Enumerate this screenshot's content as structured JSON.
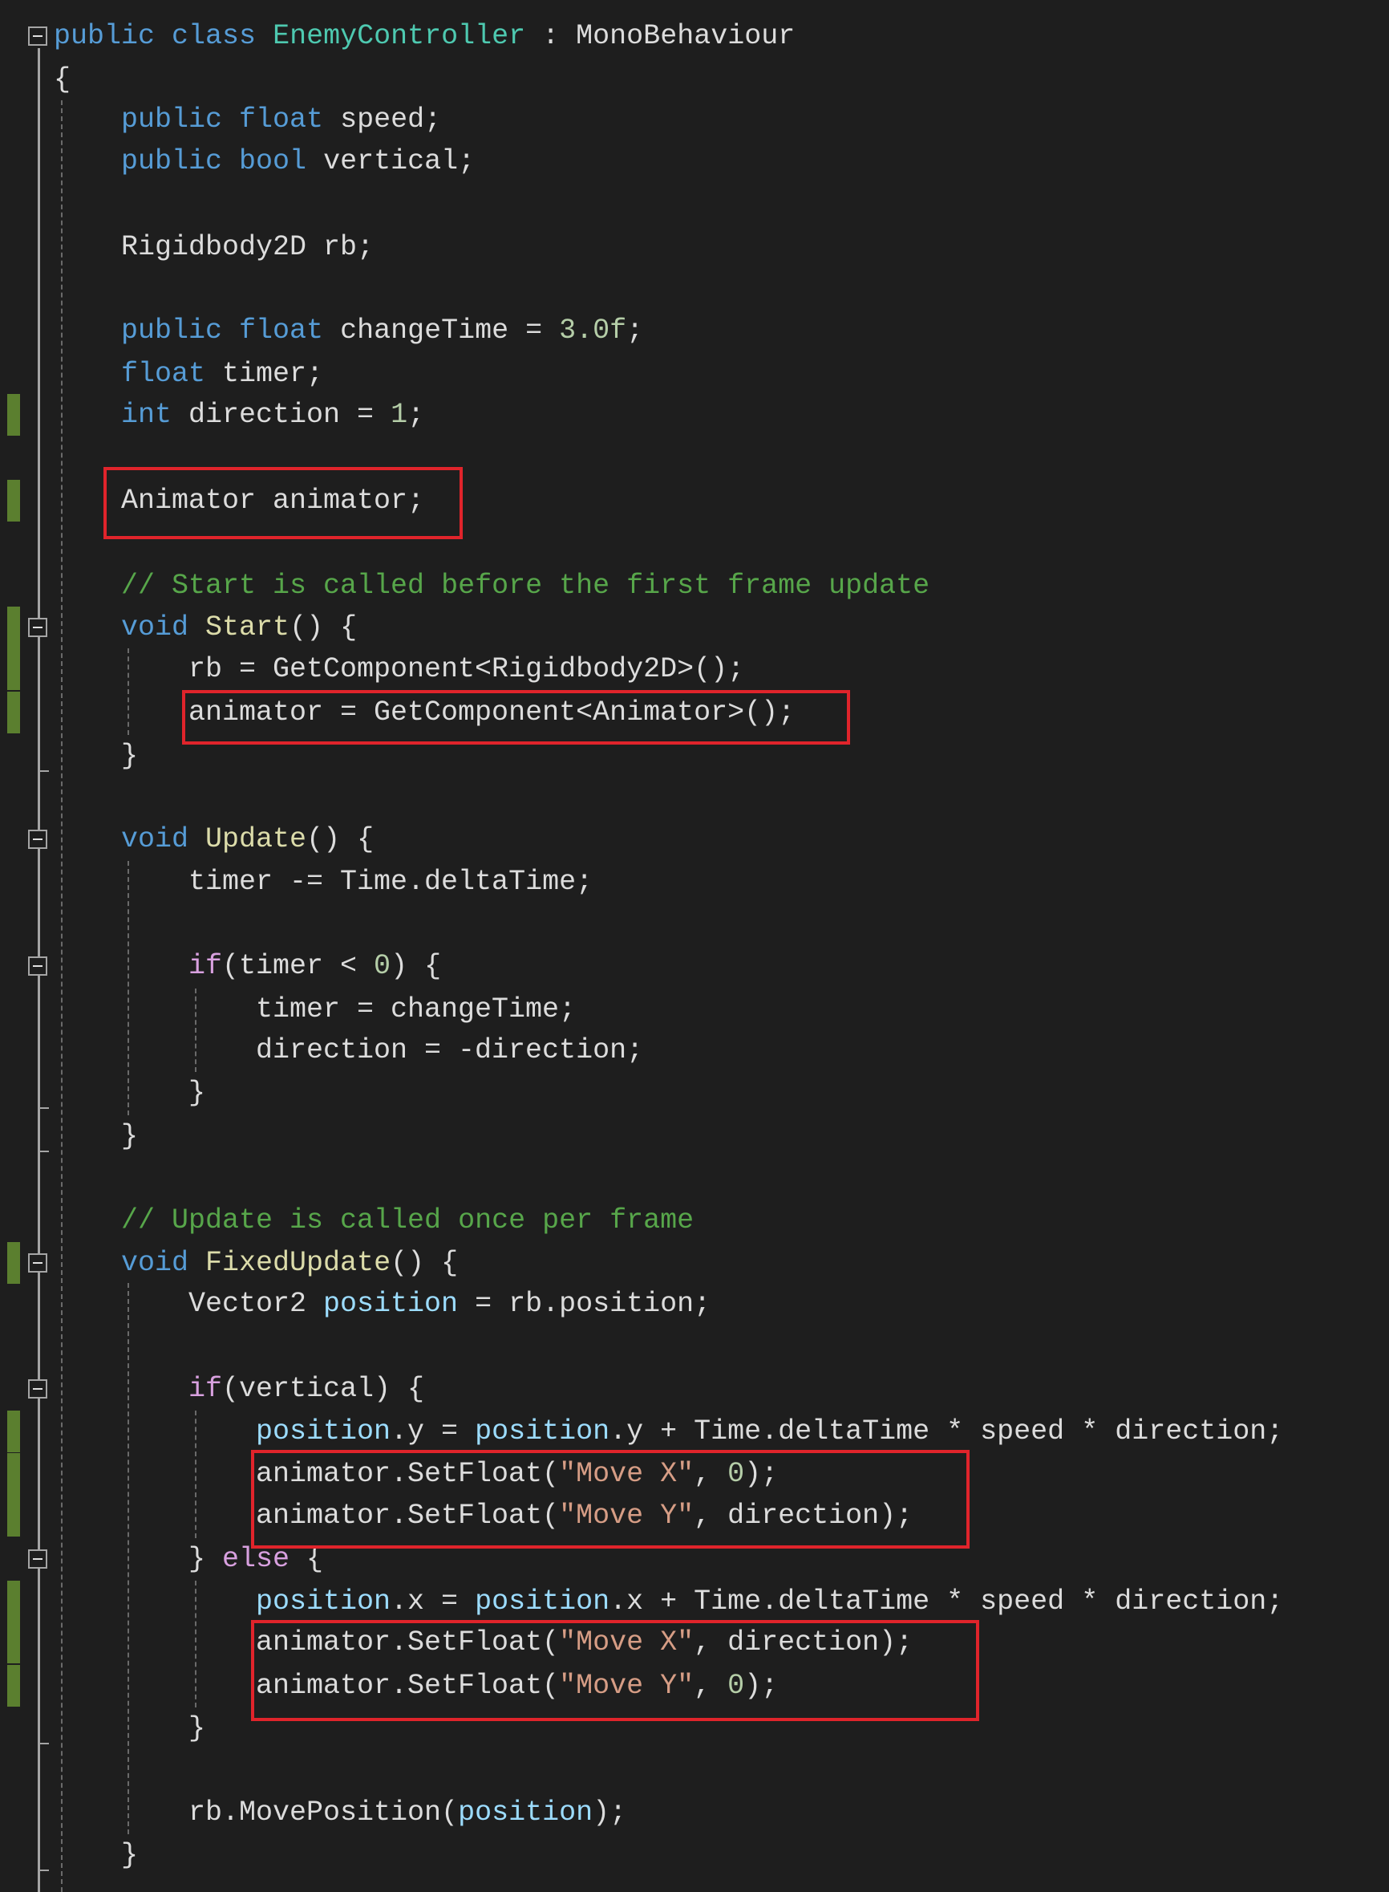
{
  "editor": {
    "language": "C#",
    "colors": {
      "background": "#1e1e1e",
      "keyword": "#569cd6",
      "control_keyword": "#d8a0df",
      "type": "#4ec9b0",
      "method": "#dcdcaa",
      "string": "#d69d85",
      "number": "#b5cea8",
      "comment": "#57a64a",
      "local_variable": "#9cdcfe",
      "plain": "#dcdcdc",
      "change_marker": "#5b7f2f",
      "highlight_box": "#e0242b"
    },
    "lines": [
      {
        "indent": 0,
        "tokens": [
          [
            "kw",
            "public"
          ],
          [
            "plain",
            " "
          ],
          [
            "kw",
            "class"
          ],
          [
            "plain",
            " "
          ],
          [
            "type",
            "EnemyController"
          ],
          [
            "plain",
            " : "
          ],
          [
            "plain",
            "MonoBehaviour"
          ]
        ]
      },
      {
        "indent": 0,
        "tokens": [
          [
            "plain",
            "{"
          ]
        ]
      },
      {
        "indent": 1,
        "tokens": [
          [
            "kw",
            "public"
          ],
          [
            "plain",
            " "
          ],
          [
            "kw",
            "float"
          ],
          [
            "plain",
            " speed;"
          ]
        ]
      },
      {
        "indent": 1,
        "tokens": [
          [
            "kw",
            "public"
          ],
          [
            "plain",
            " "
          ],
          [
            "kw",
            "bool"
          ],
          [
            "plain",
            " vertical;"
          ]
        ]
      },
      {
        "indent": 1,
        "tokens": [
          [
            "plain",
            "Rigidbody2D rb;"
          ]
        ]
      },
      {
        "indent": 1,
        "tokens": [
          [
            "kw",
            "public"
          ],
          [
            "plain",
            " "
          ],
          [
            "kw",
            "float"
          ],
          [
            "plain",
            " changeTime = "
          ],
          [
            "num",
            "3.0f"
          ],
          [
            "plain",
            ";"
          ]
        ]
      },
      {
        "indent": 1,
        "tokens": [
          [
            "kw",
            "float"
          ],
          [
            "plain",
            " timer;"
          ]
        ]
      },
      {
        "indent": 1,
        "tokens": [
          [
            "kw",
            "int"
          ],
          [
            "plain",
            " direction = "
          ],
          [
            "num",
            "1"
          ],
          [
            "plain",
            ";"
          ]
        ]
      },
      {
        "indent": 1,
        "tokens": [
          [
            "plain",
            "Animator animator;"
          ]
        ]
      },
      {
        "indent": 1,
        "tokens": [
          [
            "cmt",
            "// Start is called before the first frame update"
          ]
        ]
      },
      {
        "indent": 1,
        "tokens": [
          [
            "kw",
            "void"
          ],
          [
            "plain",
            " "
          ],
          [
            "fn",
            "Start"
          ],
          [
            "plain",
            "() {"
          ]
        ]
      },
      {
        "indent": 2,
        "tokens": [
          [
            "plain",
            "rb = GetComponent<Rigidbody2D>();"
          ]
        ]
      },
      {
        "indent": 2,
        "tokens": [
          [
            "plain",
            "animator = GetComponent<Animator>();"
          ]
        ]
      },
      {
        "indent": 1,
        "tokens": [
          [
            "plain",
            "}"
          ]
        ]
      },
      {
        "indent": 1,
        "tokens": [
          [
            "kw",
            "void"
          ],
          [
            "plain",
            " "
          ],
          [
            "fn",
            "Update"
          ],
          [
            "plain",
            "() {"
          ]
        ]
      },
      {
        "indent": 2,
        "tokens": [
          [
            "plain",
            "timer -= Time.deltaTime;"
          ]
        ]
      },
      {
        "indent": 2,
        "tokens": [
          [
            "ctl",
            "if"
          ],
          [
            "plain",
            "(timer < "
          ],
          [
            "num",
            "0"
          ],
          [
            "plain",
            ") {"
          ]
        ]
      },
      {
        "indent": 3,
        "tokens": [
          [
            "plain",
            "timer = changeTime;"
          ]
        ]
      },
      {
        "indent": 3,
        "tokens": [
          [
            "plain",
            "direction = -direction;"
          ]
        ]
      },
      {
        "indent": 2,
        "tokens": [
          [
            "plain",
            "}"
          ]
        ]
      },
      {
        "indent": 1,
        "tokens": [
          [
            "plain",
            "}"
          ]
        ]
      },
      {
        "indent": 1,
        "tokens": [
          [
            "cmt",
            "// Update is called once per frame"
          ]
        ]
      },
      {
        "indent": 1,
        "tokens": [
          [
            "kw",
            "void"
          ],
          [
            "plain",
            " "
          ],
          [
            "fn",
            "FixedUpdate"
          ],
          [
            "plain",
            "() {"
          ]
        ]
      },
      {
        "indent": 2,
        "tokens": [
          [
            "plain",
            "Vector2 "
          ],
          [
            "var",
            "position"
          ],
          [
            "plain",
            " = rb.position;"
          ]
        ]
      },
      {
        "indent": 2,
        "tokens": [
          [
            "ctl",
            "if"
          ],
          [
            "plain",
            "(vertical) {"
          ]
        ]
      },
      {
        "indent": 3,
        "tokens": [
          [
            "var",
            "position"
          ],
          [
            "plain",
            ".y = "
          ],
          [
            "var",
            "position"
          ],
          [
            "plain",
            ".y + Time.deltaTime * speed * direction;"
          ]
        ]
      },
      {
        "indent": 3,
        "tokens": [
          [
            "plain",
            "animator.SetFloat("
          ],
          [
            "str",
            "\"Move X\""
          ],
          [
            "plain",
            ", "
          ],
          [
            "num",
            "0"
          ],
          [
            "plain",
            ");"
          ]
        ]
      },
      {
        "indent": 3,
        "tokens": [
          [
            "plain",
            "animator.SetFloat("
          ],
          [
            "str",
            "\"Move Y\""
          ],
          [
            "plain",
            ", direction);"
          ]
        ]
      },
      {
        "indent": 2,
        "tokens": [
          [
            "plain",
            "} "
          ],
          [
            "ctl",
            "else"
          ],
          [
            "plain",
            " {"
          ]
        ]
      },
      {
        "indent": 3,
        "tokens": [
          [
            "var",
            "position"
          ],
          [
            "plain",
            ".x = "
          ],
          [
            "var",
            "position"
          ],
          [
            "plain",
            ".x + Time.deltaTime * speed * direction;"
          ]
        ]
      },
      {
        "indent": 3,
        "tokens": [
          [
            "plain",
            "animator.SetFloat("
          ],
          [
            "str",
            "\"Move X\""
          ],
          [
            "plain",
            ", direction);"
          ]
        ]
      },
      {
        "indent": 3,
        "tokens": [
          [
            "plain",
            "animator.SetFloat("
          ],
          [
            "str",
            "\"Move Y\""
          ],
          [
            "plain",
            ", "
          ],
          [
            "num",
            "0"
          ],
          [
            "plain",
            ");"
          ]
        ]
      },
      {
        "indent": 2,
        "tokens": [
          [
            "plain",
            "}"
          ]
        ]
      },
      {
        "indent": 2,
        "tokens": [
          [
            "plain",
            "rb.MovePosition("
          ],
          [
            "var",
            "position"
          ],
          [
            "plain",
            ");"
          ]
        ]
      },
      {
        "indent": 1,
        "tokens": [
          [
            "plain",
            "}"
          ]
        ]
      }
    ],
    "highlighted_lines": [
      8,
      12,
      [
        26,
        27
      ],
      [
        30,
        31
      ]
    ],
    "changed_lines": [
      7,
      8,
      10,
      11,
      12,
      22,
      25,
      26,
      27,
      29,
      30,
      31
    ],
    "fold_markers": [
      0,
      10,
      14,
      16,
      22,
      24,
      28
    ]
  }
}
